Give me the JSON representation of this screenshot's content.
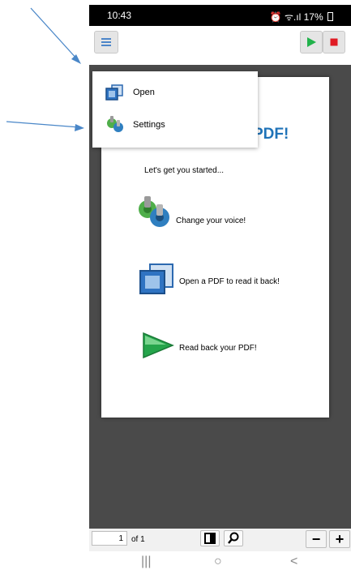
{
  "status_bar": {
    "time": "10:43",
    "status_icons": "⏰ ᯤ.ıl",
    "battery": "17%"
  },
  "toolbar": {
    "menu_icon": "hamburger-menu-icon",
    "play_icon": "play-icon",
    "stop_icon": "stop-icon",
    "play_color": "#21b24b",
    "stop_color": "#e01b24"
  },
  "menu": {
    "items": [
      {
        "label": "Open",
        "icon": "open-folder-icon"
      },
      {
        "label": "Settings",
        "icon": "settings-gears-icon"
      }
    ]
  },
  "pdf_page": {
    "title": "roPDF!",
    "subtitle": "Let's get you started...",
    "items": [
      {
        "label": "Change your voice!",
        "icon": "voice-gears-icon"
      },
      {
        "label": "Open a PDF to read it back!",
        "icon": "open-pdf-icon"
      },
      {
        "label": "Read back your PDF!",
        "icon": "read-back-play-icon"
      }
    ]
  },
  "bottom_bar": {
    "page_number": "1",
    "page_total": "of 1",
    "zoom_out": "−",
    "zoom_in": "+"
  },
  "nav_bar": {
    "recents": "|||",
    "home": "○",
    "back": "<"
  },
  "colors": {
    "accent_blue": "#1f73b8",
    "viewer_bg": "#4a4a4a"
  }
}
